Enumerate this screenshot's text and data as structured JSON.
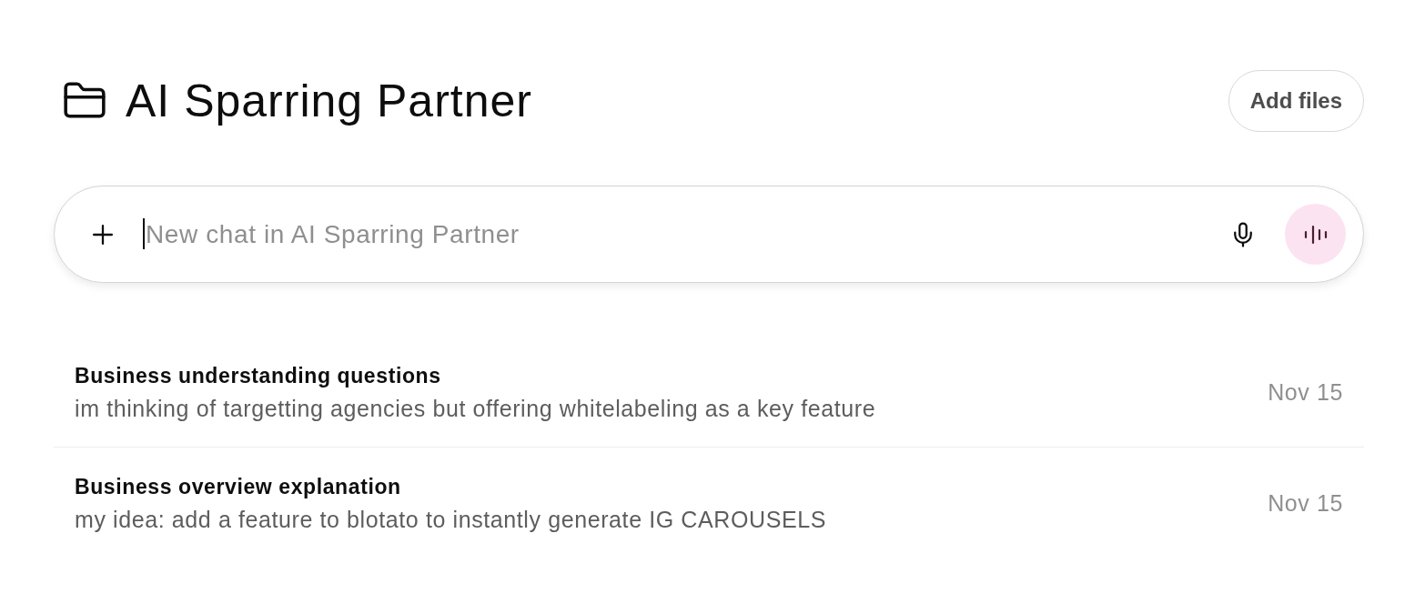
{
  "header": {
    "title": "AI Sparring Partner",
    "add_files_button": "Add files"
  },
  "composer": {
    "placeholder": "New chat in AI Sparring Partner",
    "focused": true
  },
  "chats": [
    {
      "title": "Business understanding questions",
      "preview": "im thinking of targetting agencies but offering whitelabeling as a key feature",
      "date": "Nov 15"
    },
    {
      "title": "Business overview explanation",
      "preview": "my idea: add a feature to blotato to instantly generate IG CAROUSELS",
      "date": "Nov 15"
    }
  ]
}
